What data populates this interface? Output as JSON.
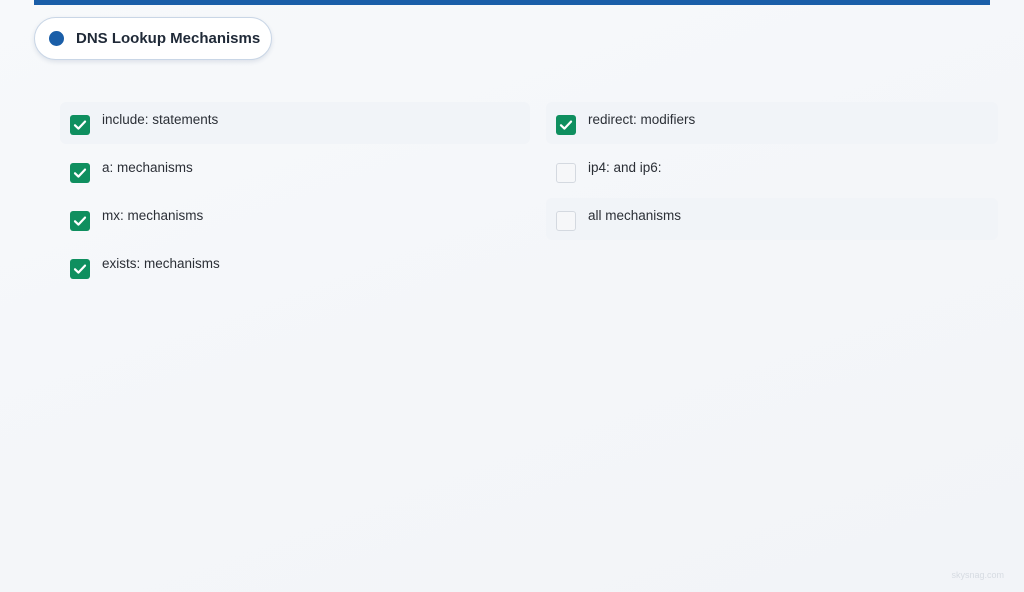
{
  "header": {
    "title": "DNS Lookup Mechanisms",
    "accent_color": "#1a5ea8"
  },
  "mechanisms": {
    "left": [
      {
        "label": "include: statements",
        "checked": true
      },
      {
        "label": "a: mechanisms",
        "checked": true
      },
      {
        "label": "mx: mechanisms",
        "checked": true
      },
      {
        "label": "exists: mechanisms",
        "checked": true
      }
    ],
    "right": [
      {
        "label": "redirect: modifiers",
        "checked": true
      },
      {
        "label": "ip4: and ip6:",
        "checked": false
      },
      {
        "label": "all mechanisms",
        "checked": false
      }
    ]
  },
  "check_color": "#0f8f5f",
  "watermark": "skysnag.com"
}
